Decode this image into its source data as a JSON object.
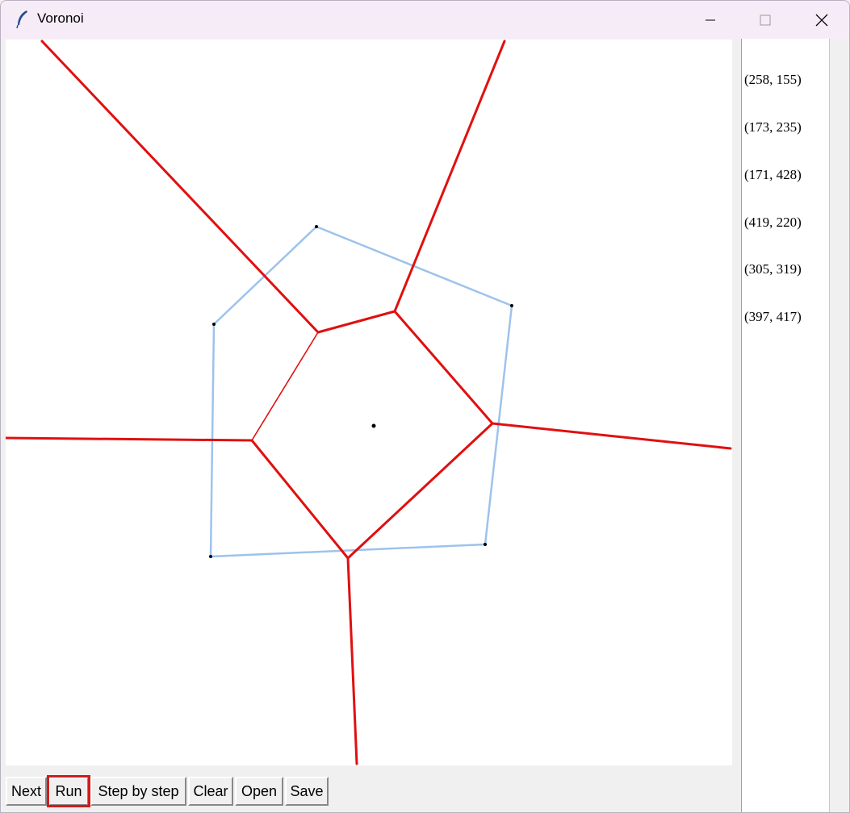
{
  "window": {
    "title": "Voronoi",
    "icon": "feather-icon",
    "controls": [
      "minimize-icon",
      "maximize-icon",
      "close-icon"
    ]
  },
  "points_list": [
    "(258, 155)",
    "(173, 235)",
    "(171, 428)",
    "(419, 220)",
    "(305, 319)",
    "(397, 417)"
  ],
  "toolbar": {
    "next_label": "Next",
    "run_label": "Run",
    "step_label": "Step by step",
    "clear_label": "Clear",
    "open_label": "Open",
    "save_label": "Save"
  },
  "colors": {
    "voronoi_edge": "#e01010",
    "convex_hull": "#9dc3ec",
    "site": "#000000",
    "highlight": "#d01c1c"
  }
}
